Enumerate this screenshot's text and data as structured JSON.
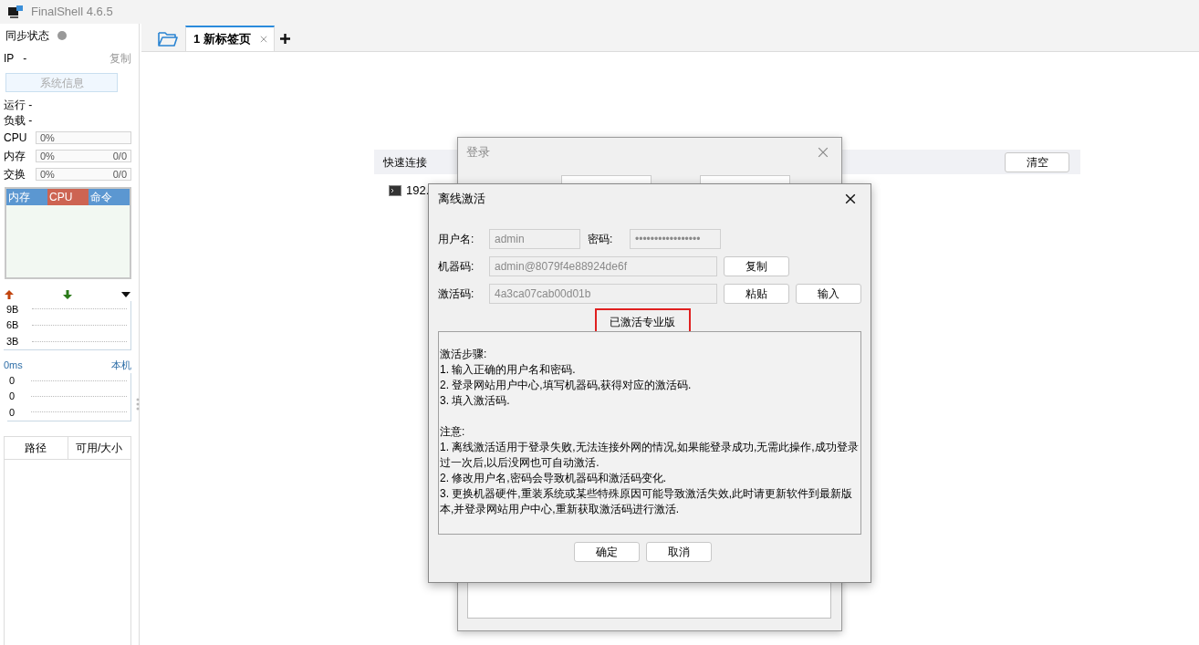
{
  "window": {
    "title": "FinalShell 4.6.5"
  },
  "sidebar": {
    "sync_label": "同步状态",
    "ip_label": "IP",
    "ip_value": "-",
    "copy_link": "复制",
    "sysinfo_button": "系统信息",
    "uptime": "运行 -",
    "load": "负载 -",
    "meters": [
      {
        "label": "CPU",
        "percent": "0%",
        "level": 0
      },
      {
        "label": "内存",
        "percent": "0%",
        "amount": "0/0",
        "level": 0
      },
      {
        "label": "交换",
        "percent": "0%",
        "amount": "0/0",
        "level": 0
      }
    ],
    "monitor_tabs": [
      {
        "label": "内存",
        "selected": false
      },
      {
        "label": "CPU",
        "selected": true
      },
      {
        "label": "命令",
        "selected": false
      }
    ],
    "network_ticks": [
      "9B",
      "6B",
      "3B"
    ],
    "ping": {
      "latency": "0ms",
      "host": "本机",
      "ticks": [
        "0",
        "0",
        "0"
      ]
    },
    "disk_table": {
      "columns": [
        "路径",
        "可用/大小"
      ]
    }
  },
  "tabs": [
    {
      "label": "1 新标签页",
      "selected": true
    }
  ],
  "quick_connect": {
    "title": "快速连接",
    "clear_button": "清空",
    "items": [
      {
        "name": "192."
      }
    ]
  },
  "login_dialog": {
    "title": "登录"
  },
  "activation_dialog": {
    "title": "离线激活",
    "username_label": "用户名:",
    "username": "admin",
    "password_label": "密码:",
    "password": "•••••••••••••••••",
    "machine_label": "机器码:",
    "machine_code": "admin@8079f4e88924de6f",
    "copy_button": "复制",
    "code_label": "激活码:",
    "code": "4a3ca07cab00d01b",
    "paste_button": "粘贴",
    "input_button": "输入",
    "status": "已激活专业版",
    "steps_title": "激活步骤:",
    "steps": [
      "1. 输入正确的用户名和密码.",
      "2. 登录网站用户中心,填写机器码,获得对应的激活码.",
      "3. 填入激活码."
    ],
    "notes_title": "注意:",
    "notes": [
      "1. 离线激活适用于登录失败,无法连接外网的情况,如果能登录成功,无需此操作,成功登录过一次后,以后没网也可自动激活.",
      "2. 修改用户名,密码会导致机器码和激活码变化.",
      "3. 更换机器硬件,重装系统或某些特殊原因可能导致激活失效,此时请更新软件到最新版本,并登录网站用户中心,重新获取激活码进行激活."
    ],
    "ok_button": "确定",
    "cancel_button": "取消"
  }
}
